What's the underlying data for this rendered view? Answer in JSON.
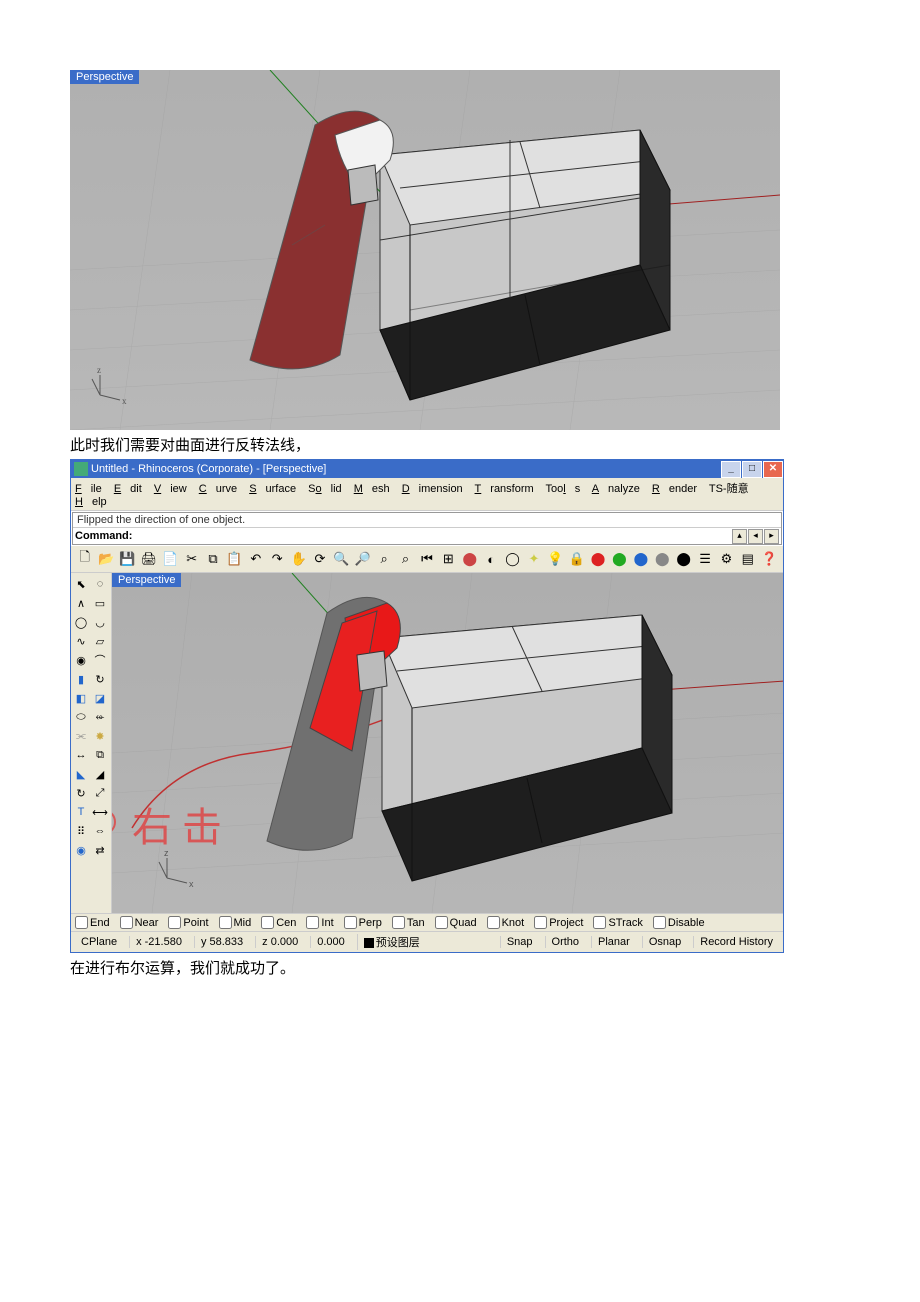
{
  "viewport1": {
    "label": "Perspective"
  },
  "caption1": "此时我们需要对曲面进行反转法线，",
  "app": {
    "title": "Untitled - Rhinoceros (Corporate) - [Perspective]",
    "menu": [
      "File",
      "Edit",
      "View",
      "Curve",
      "Surface",
      "Solid",
      "Mesh",
      "Dimension",
      "Transform",
      "Tools",
      "Analyze",
      "Render",
      "TS-随意",
      "Help"
    ],
    "cmd_history": "Flipped the direction of one object.",
    "cmd_label": "Command:",
    "viewport_label": "Perspective",
    "annotation": "右 击",
    "osnap": [
      "End",
      "Near",
      "Point",
      "Mid",
      "Cen",
      "Int",
      "Perp",
      "Tan",
      "Quad",
      "Knot",
      "Project",
      "STrack",
      "Disable"
    ],
    "status": {
      "cplane": "CPlane",
      "x": "x -21.580",
      "y": "y 58.833",
      "z": "z 0.000",
      "extra": "0.000",
      "layer": "预设图层",
      "panes": [
        "Snap",
        "Ortho",
        "Planar",
        "Osnap",
        "Record History"
      ]
    }
  },
  "caption2": "在进行布尔运算，我们就成功了。"
}
